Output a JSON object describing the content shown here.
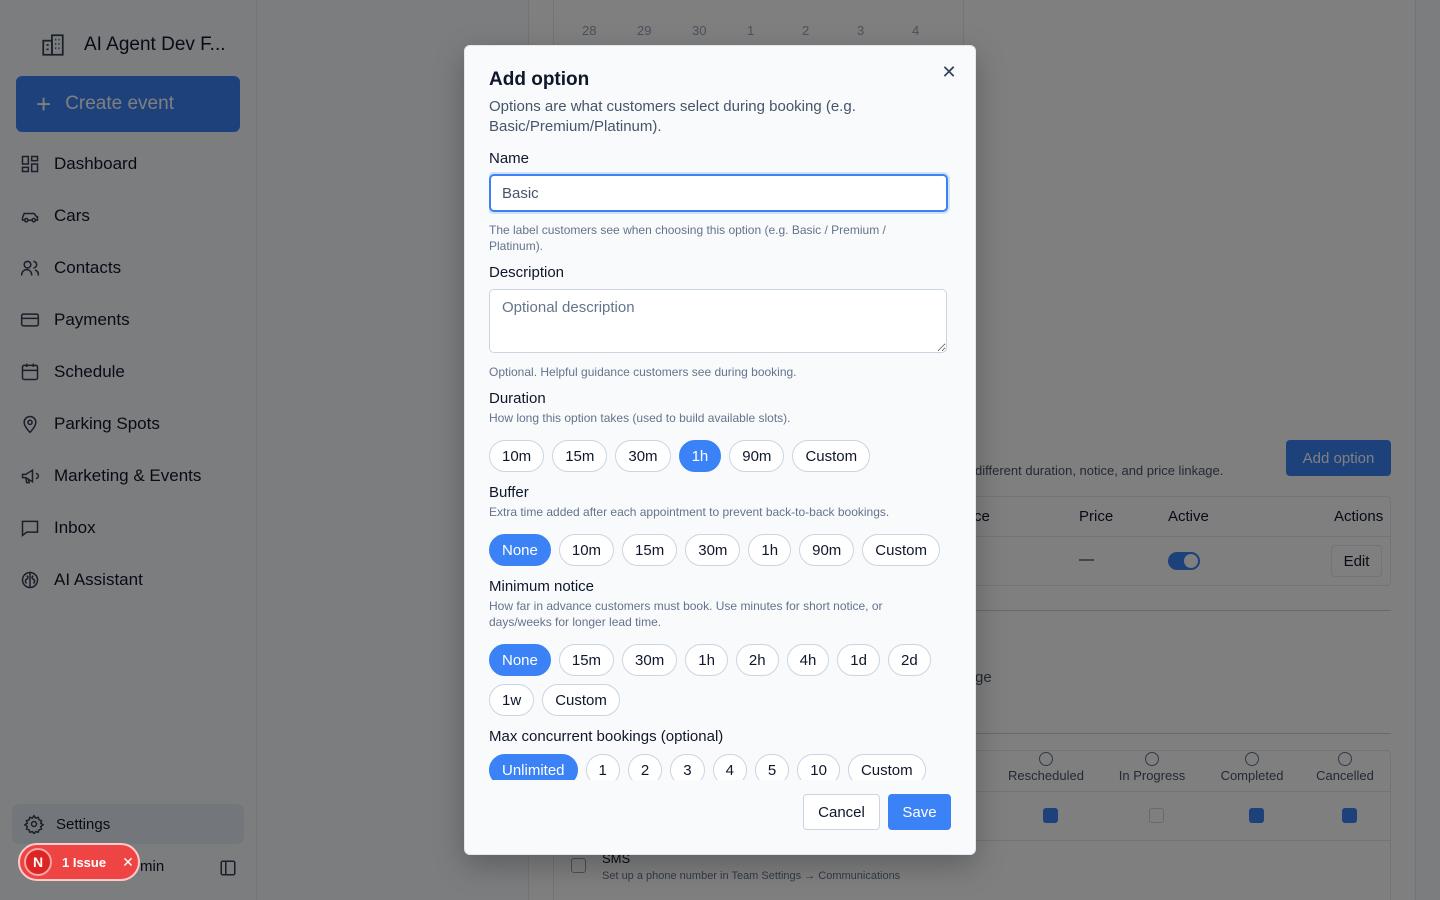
{
  "app": {
    "workspace_name": "AI Agent Dev F...",
    "create_event_label": "Create event"
  },
  "sidebar": {
    "items": [
      {
        "label": "Dashboard",
        "icon": "dashboard-icon"
      },
      {
        "label": "Cars",
        "icon": "car-icon"
      },
      {
        "label": "Contacts",
        "icon": "users-icon"
      },
      {
        "label": "Payments",
        "icon": "credit-card-icon"
      },
      {
        "label": "Schedule",
        "icon": "calendar-icon"
      },
      {
        "label": "Parking Spots",
        "icon": "map-pin-icon"
      },
      {
        "label": "Marketing & Events",
        "icon": "megaphone-icon"
      },
      {
        "label": "Inbox",
        "icon": "message-icon"
      },
      {
        "label": "AI Assistant",
        "icon": "brain-icon"
      }
    ],
    "settings_label": "Settings",
    "user_label_partial": "min",
    "issue_badge": {
      "avatar_letter": "N",
      "label": "1 Issue"
    }
  },
  "background": {
    "calendar_days": [
      "28",
      "29",
      "30",
      "1",
      "2",
      "3",
      "4"
    ],
    "add_option_label": "Add option",
    "hint_partial": "different duration, notice, and price linkage.",
    "table_headers": {
      "col1_partial": "ce",
      "price": "Price",
      "active": "Active",
      "actions": "Actions"
    },
    "row": {
      "price": "—",
      "active": true,
      "edit_label": "Edit"
    },
    "ge_partial": "ge",
    "notif_headers": [
      "Rescheduled",
      "In Progress",
      "Completed",
      "Cancelled"
    ],
    "sms_label": "SMS",
    "sms_sub": "Set up a phone number in Team Settings → Communications"
  },
  "modal": {
    "title": "Add option",
    "description": "Options are what customers select during booking (e.g. Basic/Premium/Platinum).",
    "name": {
      "label": "Name",
      "value": "",
      "placeholder": "Basic",
      "help": "The label customers see when choosing this option (e.g. Basic / Premium / Platinum)."
    },
    "description_field": {
      "label": "Description",
      "placeholder": "Optional description",
      "help": "Optional. Helpful guidance customers see during booking."
    },
    "duration": {
      "label": "Duration",
      "help": "How long this option takes (used to build available slots).",
      "options": [
        "10m",
        "15m",
        "30m",
        "1h",
        "90m",
        "Custom"
      ],
      "selected": "1h"
    },
    "buffer": {
      "label": "Buffer",
      "help": "Extra time added after each appointment to prevent back-to-back bookings.",
      "options": [
        "None",
        "10m",
        "15m",
        "30m",
        "1h",
        "90m",
        "Custom"
      ],
      "selected": "None"
    },
    "minimum_notice": {
      "label": "Minimum notice",
      "help": "How far in advance customers must book. Use minutes for short notice, or days/weeks for longer lead time.",
      "options": [
        "None",
        "15m",
        "30m",
        "1h",
        "2h",
        "4h",
        "1d",
        "2d",
        "1w",
        "Custom"
      ],
      "selected": "None"
    },
    "max_concurrent": {
      "label": "Max concurrent bookings (optional)",
      "options": [
        "Unlimited",
        "1",
        "2",
        "3",
        "4",
        "5",
        "10",
        "Custom"
      ],
      "selected": "Unlimited"
    },
    "cancel_label": "Cancel",
    "save_label": "Save"
  },
  "colors": {
    "accent": "#3b82f6",
    "overlay": "rgba(0,0,0,0.5)",
    "danger": "#ef4444"
  }
}
